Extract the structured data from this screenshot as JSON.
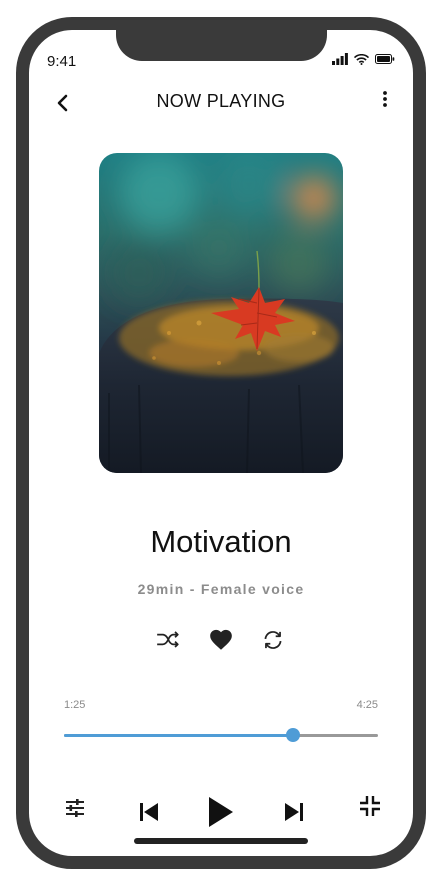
{
  "status_bar": {
    "time": "9:41"
  },
  "header": {
    "title": "NOW PLAYING"
  },
  "track": {
    "title": "Motivation",
    "subtitle": "29min - Female voice"
  },
  "playback": {
    "elapsed": "1:25",
    "duration": "4:25",
    "progress_fraction": 0.73
  },
  "colors": {
    "accent": "#4f9cd6",
    "track_remaining": "#999999",
    "frame": "#3a3a3a",
    "text": "#111111",
    "subtext": "#8c8c8c"
  },
  "icons": {
    "back": "chevron-left-icon",
    "more": "more-vertical-icon",
    "shuffle": "shuffle-icon",
    "favorite": "heart-icon",
    "repeat": "repeat-icon",
    "equalizer": "sliders-icon",
    "previous": "skip-previous-icon",
    "play": "play-icon",
    "next": "skip-next-icon",
    "minimize": "minimize-icon"
  }
}
